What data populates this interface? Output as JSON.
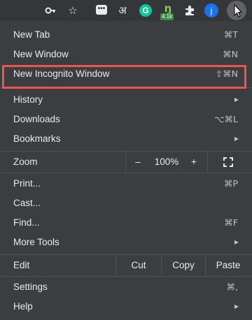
{
  "toolbar": {
    "icons": [
      "key-icon",
      "star-icon",
      "extension-icon",
      "hindi-extension-icon",
      "grammarly-icon",
      "extension-icon",
      "puzzle-icon",
      "avatar",
      "more-menu-icon"
    ],
    "devanagari_label": "अ",
    "grammarly_label": "G",
    "ext_badge": "4.1k",
    "avatar_initial": "j"
  },
  "menu": {
    "new_tab": {
      "label": "New Tab",
      "shortcut": "⌘T"
    },
    "new_window": {
      "label": "New Window",
      "shortcut": "⌘N"
    },
    "new_incognito": {
      "label": "New Incognito Window",
      "shortcut": "⇧⌘N"
    },
    "history": {
      "label": "History"
    },
    "downloads": {
      "label": "Downloads",
      "shortcut": "⌥⌘L"
    },
    "bookmarks": {
      "label": "Bookmarks"
    },
    "zoom": {
      "label": "Zoom",
      "minus": "–",
      "level": "100%",
      "plus": "+"
    },
    "print": {
      "label": "Print...",
      "shortcut": "⌘P"
    },
    "cast": {
      "label": "Cast..."
    },
    "find": {
      "label": "Find...",
      "shortcut": "⌘F"
    },
    "more_tools": {
      "label": "More Tools"
    },
    "edit": {
      "label": "Edit",
      "cut": "Cut",
      "copy": "Copy",
      "paste": "Paste"
    },
    "settings": {
      "label": "Settings",
      "shortcut": "⌘,"
    },
    "help": {
      "label": "Help"
    }
  },
  "colors": {
    "menu_bg": "#3b3d40",
    "highlight_border": "#e8574d"
  }
}
